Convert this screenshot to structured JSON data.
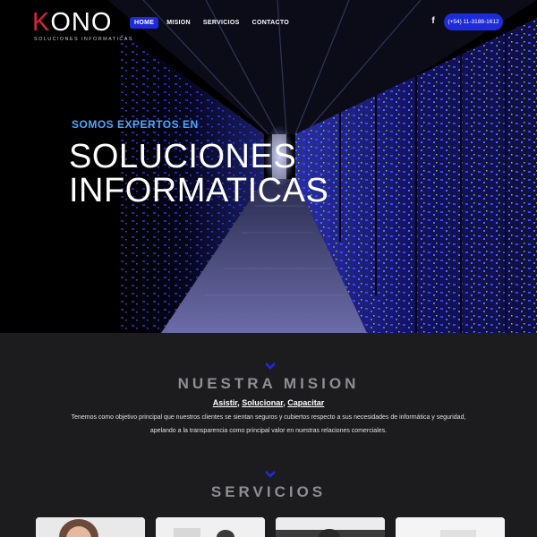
{
  "nav": {
    "logo_text": "KONO",
    "logo_sub": "SOLUCIONES INFORMATICAS",
    "items": [
      {
        "label": "HOME",
        "active": true
      },
      {
        "label": "MISION",
        "active": false
      },
      {
        "label": "SERVICIOS",
        "active": false
      },
      {
        "label": "CONTACTO",
        "active": false
      }
    ],
    "facebook_icon": "facebook-icon",
    "phone": "(+54) 11-3188-1612"
  },
  "hero": {
    "kicker": "SOMOS EXPERTOS EN",
    "title_line1": "SOLUCIONES",
    "title_line2": "INFORMATICAS"
  },
  "mision": {
    "title": "NUESTRA MISION",
    "link1": "Asistir",
    "link2": "Solucionar",
    "link3": "Capacitar",
    "text_line1": "Tenemos como objetivo principal que nuestros clientes se sientan seguros y cubiertos respecto a sus necesidades de informática y seguridad,",
    "text_line2": "apelando a la transparencia como principal valor en nuestras relaciones comerciales."
  },
  "servicios": {
    "title": "SERVICIOS"
  },
  "colors": {
    "accent": "#1d2bd8",
    "kicker": "#4aa8ff",
    "logo_k": "#d8243a",
    "section_bg": "#1c1c1e"
  }
}
